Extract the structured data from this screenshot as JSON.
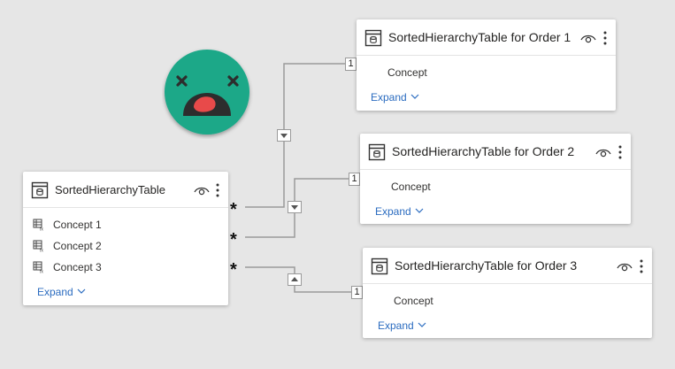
{
  "main_table": {
    "title": "SortedHierarchyTable",
    "fields": [
      "Concept 1",
      "Concept 2",
      "Concept 3"
    ],
    "expand_label": "Expand"
  },
  "order_tables": [
    {
      "title": "SortedHierarchyTable for Order 1",
      "field": "Concept",
      "expand_label": "Expand"
    },
    {
      "title": "SortedHierarchyTable for Order 2",
      "field": "Concept",
      "expand_label": "Expand"
    },
    {
      "title": "SortedHierarchyTable for Order 3",
      "field": "Concept",
      "expand_label": "Expand"
    }
  ],
  "relationships": [
    {
      "from_cardinality": "*",
      "to_cardinality": "1",
      "direction": "down"
    },
    {
      "from_cardinality": "*",
      "to_cardinality": "1",
      "direction": "down"
    },
    {
      "from_cardinality": "*",
      "to_cardinality": "1",
      "direction": "up"
    }
  ],
  "colors": {
    "background": "#e6e6e6",
    "expand_link": "#2b6cc0",
    "face": "#1aa888",
    "face_mouth": "#2d2d2d",
    "face_tongue": "#e84a4a"
  },
  "icons": {
    "table": "table-icon",
    "visibility": "eye-icon",
    "more": "more-options-icon",
    "hierarchy_field": "hierarchy-field-icon",
    "expand": "chevron-down-icon",
    "sticker": "dead-face-sticker"
  }
}
